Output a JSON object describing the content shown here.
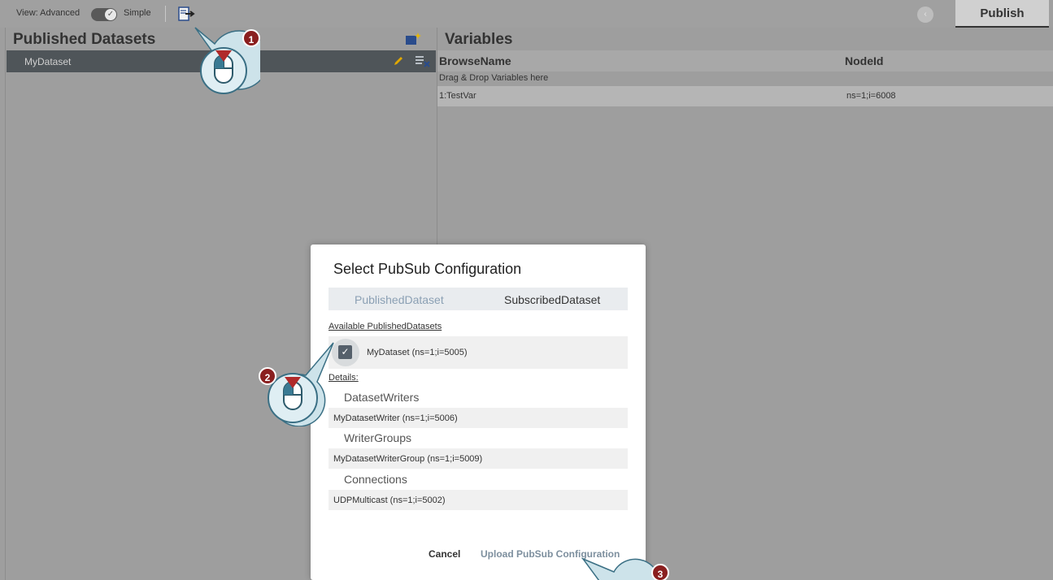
{
  "toolbar": {
    "view_label": "View: Advanced",
    "simple_label": "Simple",
    "publish_tab": "Publish",
    "back_icon": "chevron-left-icon",
    "export_icon": "export-arrow-icon"
  },
  "left_panel": {
    "title": "Published Datasets",
    "add_icon": "add-dataset-icon",
    "rows": [
      {
        "label": "MyDataset",
        "edit_icon": "pencil-icon",
        "delete_icon": "delete-list-icon"
      }
    ]
  },
  "right_panel": {
    "title": "Variables",
    "col_browse": "BrowseName",
    "col_nodeid": "NodeId",
    "drop_hint": "Drag & Drop Variables here",
    "rows": [
      {
        "browse": "1:TestVar",
        "nodeid": "ns=1;i=6008"
      }
    ]
  },
  "dialog": {
    "title": "Select PubSub Configuration",
    "tab_published": "PublishedDataset",
    "tab_subscribed": "SubscribedDataset",
    "available_label": "Available PublishedDatasets",
    "available_item": "MyDataset (ns=1;i=5005)",
    "available_checked": true,
    "details_label": "Details:",
    "sections": [
      {
        "heading": "DatasetWriters",
        "value": "MyDatasetWriter (ns=1;i=5006)"
      },
      {
        "heading": "WriterGroups",
        "value": "MyDatasetWriterGroup (ns=1;i=5009)"
      },
      {
        "heading": "Connections",
        "value": "UDPMulticast (ns=1;i=5002)"
      }
    ],
    "cancel": "Cancel",
    "upload": "Upload PubSub Configuration"
  },
  "callouts": [
    {
      "number": "1",
      "icon": "mouse-click-icon"
    },
    {
      "number": "2",
      "icon": "mouse-click-icon"
    },
    {
      "number": "3",
      "icon": "mouse-click-icon"
    }
  ],
  "colors": {
    "overlay": "#9e9e9e",
    "selected_row": "#4f5559",
    "badge": "#8a1f1f",
    "callout_fill": "#cde3ea",
    "callout_stroke": "#3a6f84"
  }
}
